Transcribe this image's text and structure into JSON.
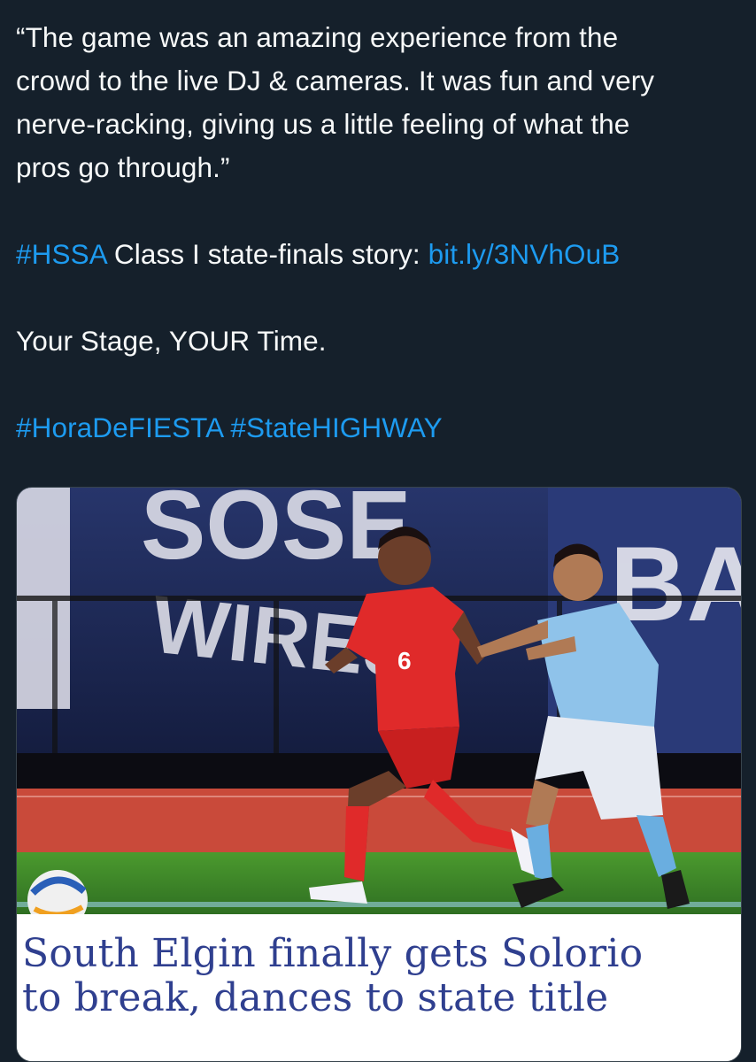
{
  "tweet": {
    "quote_line_1": "“The game was an amazing experience from the",
    "quote_line_2": "crowd to the live DJ & cameras. It was fun and very",
    "quote_line_3": "nerve-racking, giving us a little feeling of what the",
    "quote_line_4": "pros go through.”",
    "story_hashtag": "#HSSA",
    "story_text": " Class I state-finals story: ",
    "story_link": "bit.ly/3NVhOuB",
    "tagline": "Your Stage, YOUR Time.",
    "hashtag_1": "#HoraDeFIESTA",
    "hashtag_2": "#StateHIGHWAY"
  },
  "card": {
    "image_alt": "Two soccer players chasing the ball, one in a red number 6 jersey and one in a light blue jersey",
    "banner_text_top": "SOSE",
    "banner_text_bottom": "WIRES",
    "banner_text_right": "BA",
    "jersey_number": "6",
    "headline_line_1": "South Elgin finally gets Solorio",
    "headline_line_2": "to break, dances to state title"
  },
  "colors": {
    "background": "#15202b",
    "text": "#f7f9f9",
    "link": "#1d9bf0",
    "headline": "#2f3f8f",
    "red_kit": "#e02a2a",
    "blue_kit": "#8fc3ea",
    "track": "#c94a3a",
    "grass": "#3f8c2a"
  }
}
